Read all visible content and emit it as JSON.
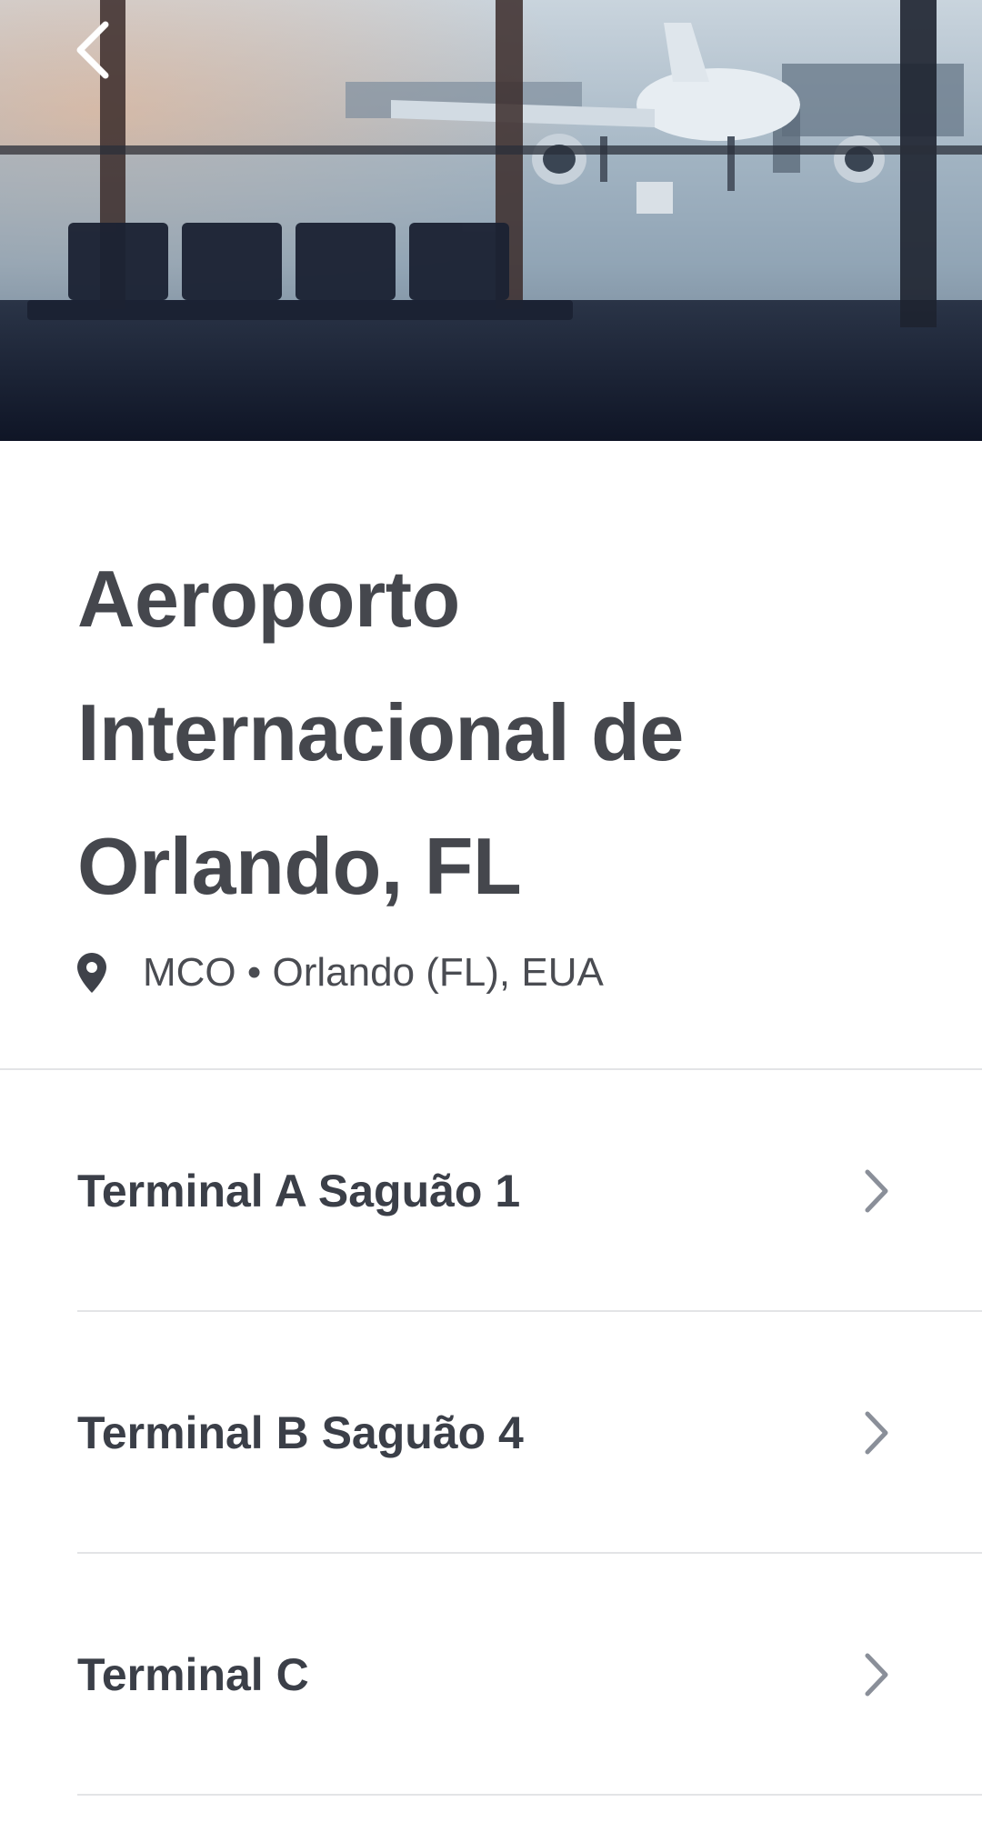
{
  "header": {
    "title": "Aeroporto Internacional de Orlando, FL",
    "location": "MCO • Orlando (FL), EUA"
  },
  "hero": {
    "image_subject": "airport terminal window with airplane"
  },
  "icons": {
    "back": "chevron-left-icon",
    "location": "map-pin-icon",
    "row": "chevron-right-icon"
  },
  "terminals": [
    {
      "label": "Terminal A Saguão 1"
    },
    {
      "label": "Terminal B Saguão 4"
    },
    {
      "label": "Terminal C"
    }
  ],
  "colors": {
    "title": "#45474d",
    "item_text": "#3b3f48",
    "chevron": "#8a8f99",
    "divider": "#e3e4e6"
  }
}
